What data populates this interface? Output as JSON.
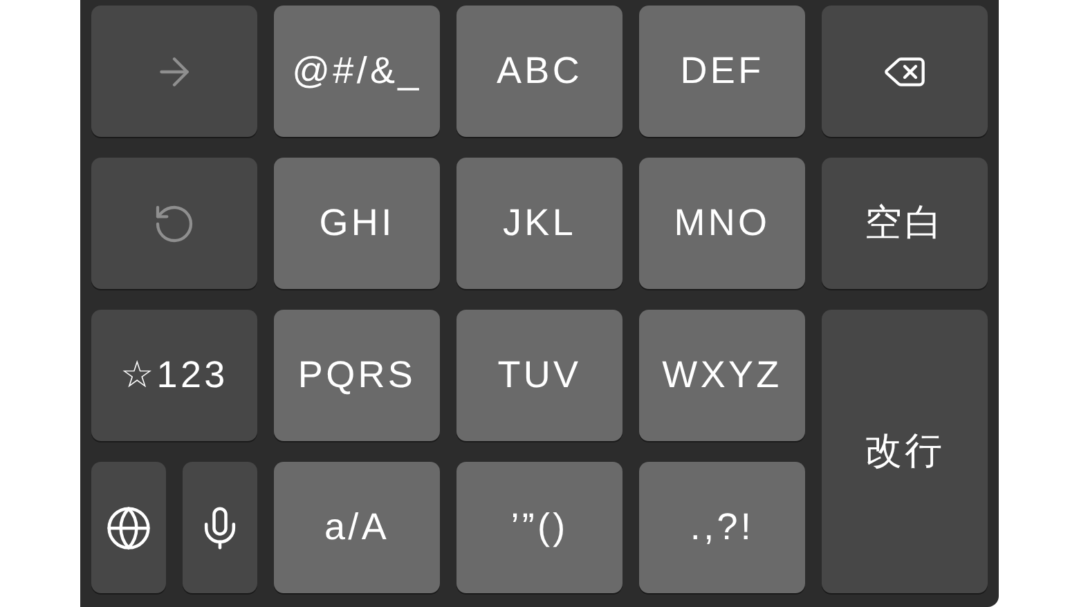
{
  "rows": [
    [
      {
        "kind": "icon",
        "disabled": true
      },
      {
        "kind": "letter",
        "label": "@#/&_",
        "disabled": false
      },
      {
        "kind": "letter",
        "label": "ABC",
        "disabled": false
      },
      {
        "kind": "letter",
        "label": "DEF",
        "disabled": false
      },
      {
        "kind": "icon",
        "disabled": false
      }
    ],
    [
      {
        "kind": "icon",
        "disabled": true
      },
      {
        "kind": "letter",
        "label": "GHI",
        "disabled": false
      },
      {
        "kind": "letter",
        "label": "JKL",
        "disabled": false
      },
      {
        "kind": "letter",
        "label": "MNO",
        "disabled": false
      },
      {
        "kind": "command",
        "label": "空白",
        "disabled": false
      }
    ],
    [
      {
        "kind": "command",
        "label": "☆123",
        "disabled": false
      },
      {
        "kind": "letter",
        "label": "PQRS",
        "disabled": false
      },
      {
        "kind": "letter",
        "label": "TUV",
        "disabled": false
      },
      {
        "kind": "letter",
        "label": "WXYZ",
        "disabled": false
      },
      {
        "kind": "command",
        "label": "改行",
        "disabled": false
      }
    ],
    [
      {
        "kind": "icon",
        "disabled": false
      },
      {
        "kind": "icon",
        "disabled": false
      },
      {
        "kind": "letter",
        "label": "a/A",
        "disabled": false
      },
      {
        "kind": "letter",
        "label": "’”()",
        "disabled": false
      },
      {
        "kind": "letter",
        "label": ".,?!",
        "disabled": false
      }
    ]
  ]
}
